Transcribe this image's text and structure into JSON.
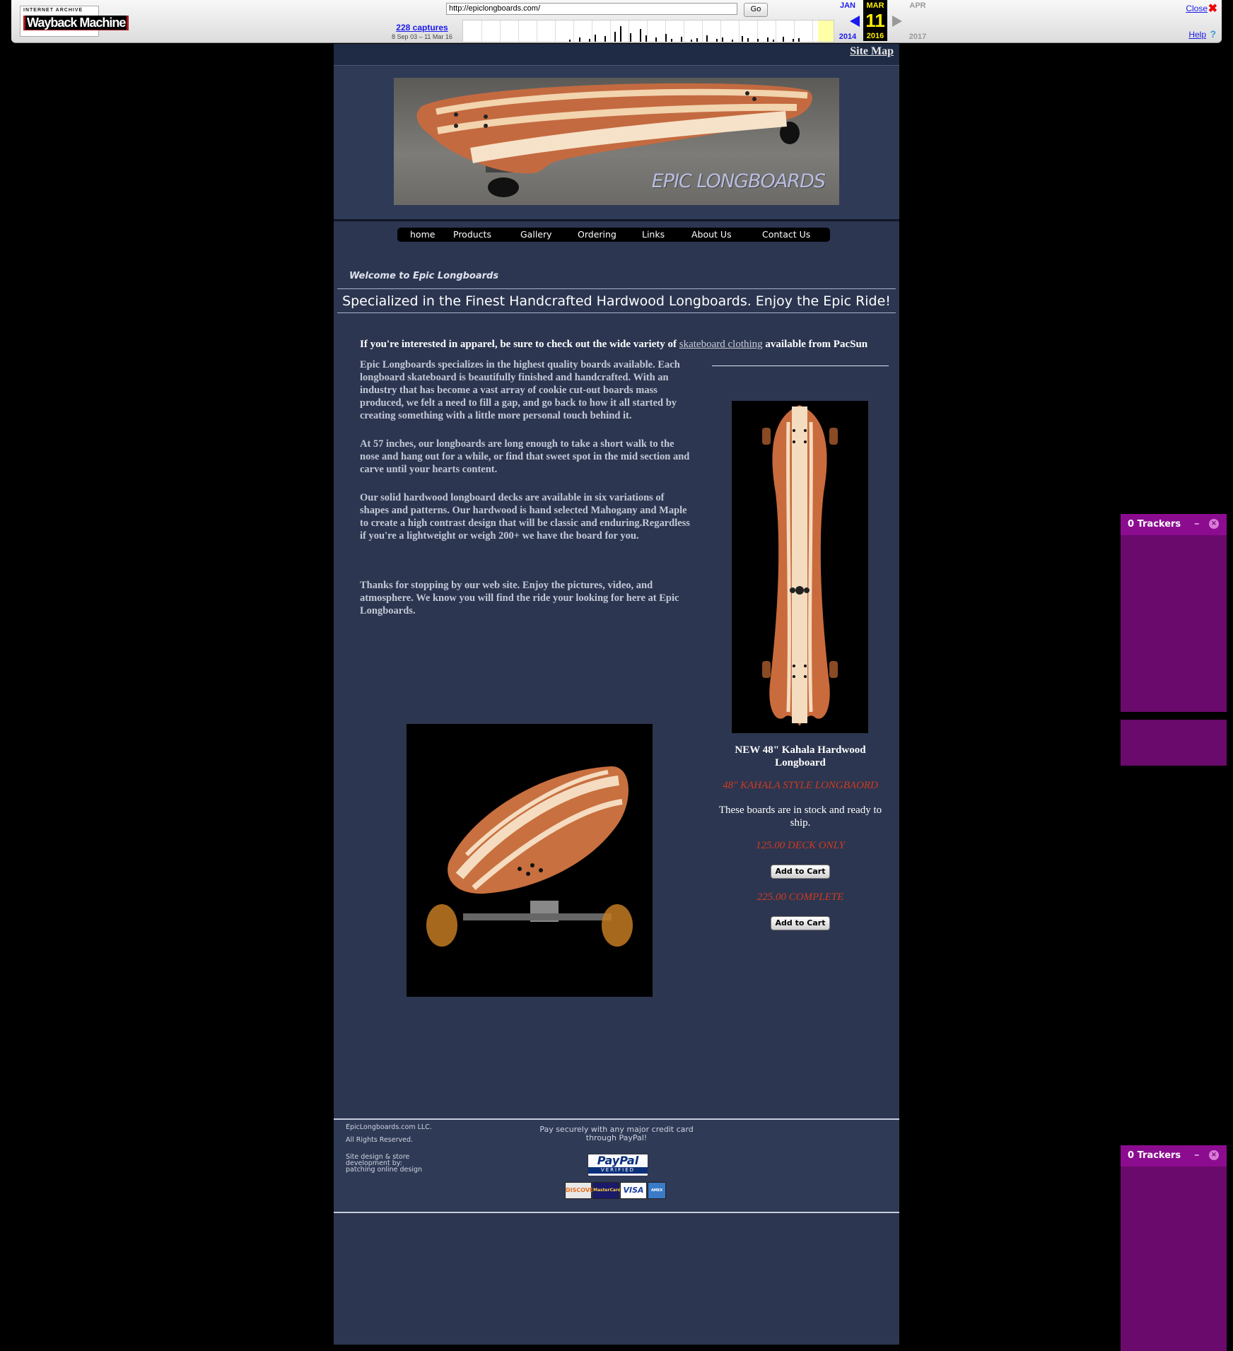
{
  "wayback": {
    "logo_top": "INTERNET ARCHIVE",
    "logo_main_a": "Wayback",
    "logo_main_b": "Machine",
    "url": "http://epiclongboards.com/",
    "go_label": "Go",
    "captures_link": "228 captures",
    "captures_range": "8 Sep 03 – 11 Mar 16",
    "prev_month": "JAN",
    "cur_month": "MAR",
    "next_month": "APR",
    "cur_day": "11",
    "prev_year": "2014",
    "cur_year": "2016",
    "next_year": "2017",
    "close_label": "Close",
    "help_label": "Help"
  },
  "site": {
    "sitemap_label": "Site Map",
    "banner_text": "EPIC LONGBOARDS",
    "nav": [
      "home",
      "Products",
      "Gallery",
      "Ordering",
      "Links",
      "About Us",
      "Contact Us"
    ],
    "welcome": "Welcome to Epic Longboards",
    "tagline": "Specialized in the Finest Handcrafted Hardwood Longboards. Enjoy the Epic Ride!",
    "apparel_pre": "If you're interested in apparel, be sure to check out the wide variety of ",
    "apparel_link": "skateboard clothing",
    "apparel_post": " available from PacSun",
    "paragraphs": [
      "Epic Longboards specializes in the highest quality boards available. Each longboard skateboard is beautifully finished and handcrafted. With an industry that has become a vast array of cookie cut-out boards mass produced, we felt a need to fill a gap, and go back to how it all started by creating something with a little more personal touch behind it.",
      "At 57 inches, our longboards are long enough to take a short walk to the nose and hang out for a while, or find that sweet spot in the mid section and carve until your hearts content.",
      "Our solid hardwood longboard decks are available in six variations of shapes and patterns. Our hardwood is hand selected Mahogany and Maple to create a high contrast design that will be classic and enduring.Regardless if you're a lightweight or weigh 200+ we have the board for you.",
      "Thanks for stopping by our web site. Enjoy the pictures, video, and atmosphere. We know you will find the ride your looking for here at Epic Longboards."
    ],
    "product": {
      "title": "NEW 48\" Kahala Hardwood Longboard",
      "style": "48\" KAHALA STYLE LONGBAORD",
      "stock": "These boards are in stock and ready to ship.",
      "price_deck": "125.00 DECK ONLY",
      "price_complete": "225.00 COMPLETE",
      "cart_label": "Add to Cart"
    },
    "footer": {
      "company": "EpicLongboards.com LLC.",
      "rights": "All Rights Reserved.",
      "credit_line1": "Site design & store",
      "credit_line2": "development by:",
      "credit_line3": "patching online design",
      "pay_text": "Pay securely with any major credit card through PayPal!",
      "paypal_main": "PayPal",
      "paypal_sub": "VERIFIED",
      "cards": [
        "DISCOVER",
        "MasterCard",
        "VISA",
        "AMEX"
      ]
    }
  },
  "trackers": {
    "title": "0  Trackers",
    "minimize": "–",
    "close": "×"
  },
  "colors": {
    "page_bg": "#000000",
    "site_bg": "#2c3650",
    "accent_red": "#d13a1f",
    "tracker_purple": "#8c0c90"
  }
}
